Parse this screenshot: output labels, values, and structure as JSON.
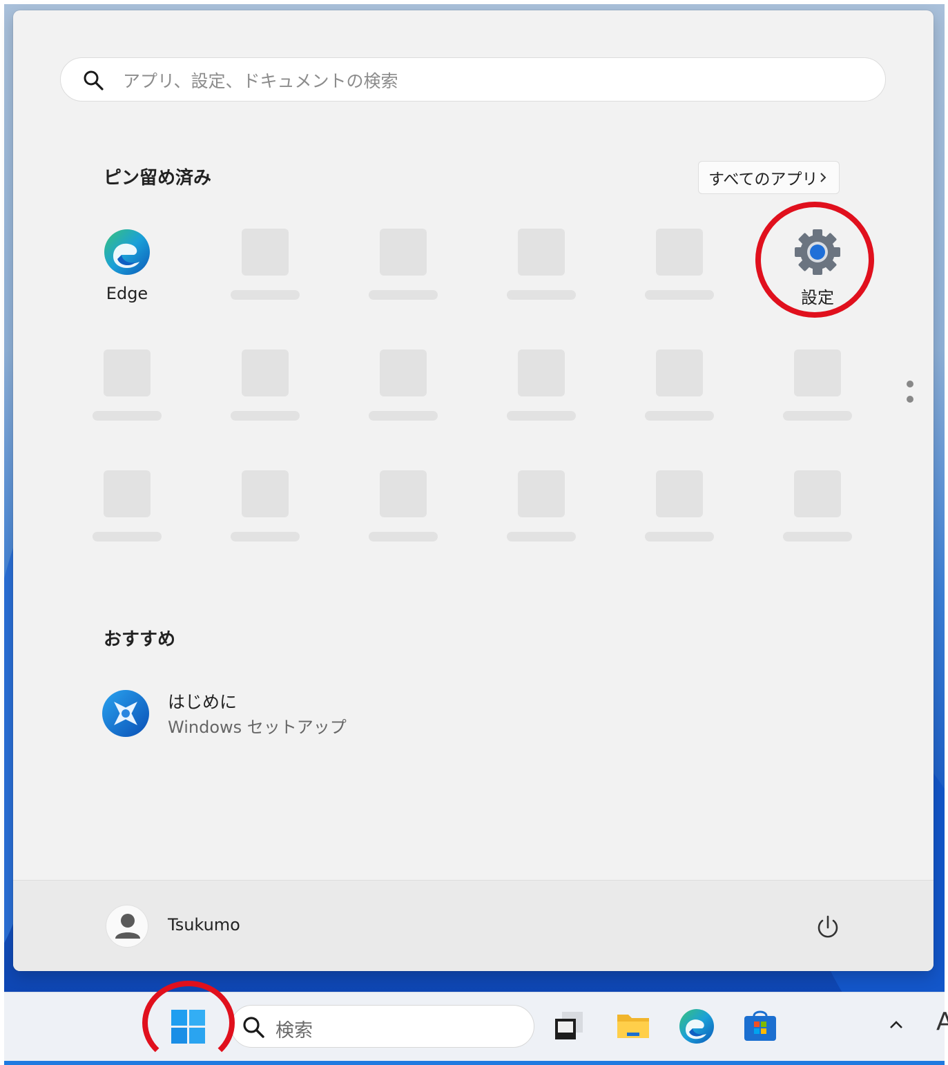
{
  "search": {
    "placeholder": "アプリ、設定、ドキュメントの検索"
  },
  "pinned": {
    "title": "ピン留め済み",
    "all_apps_label": "すべてのアプリ",
    "apps": [
      {
        "label": "Edge",
        "icon": "edge-icon"
      },
      {
        "label": "設定",
        "icon": "settings-gear-icon"
      }
    ]
  },
  "recommended": {
    "title": "おすすめ",
    "items": [
      {
        "title": "はじめに",
        "subtitle": "Windows セットアップ",
        "icon": "get-started-icon"
      }
    ]
  },
  "footer": {
    "user_name": "Tsukumo"
  },
  "taskbar": {
    "search_label": "検索",
    "tray_letter": "A",
    "icons": [
      "task-view-icon",
      "file-explorer-icon",
      "edge-icon",
      "microsoft-store-icon"
    ]
  },
  "colors": {
    "highlight_ring": "#e0101d",
    "menu_background": "#f2f2f2",
    "accent": "#1f7ae0"
  }
}
